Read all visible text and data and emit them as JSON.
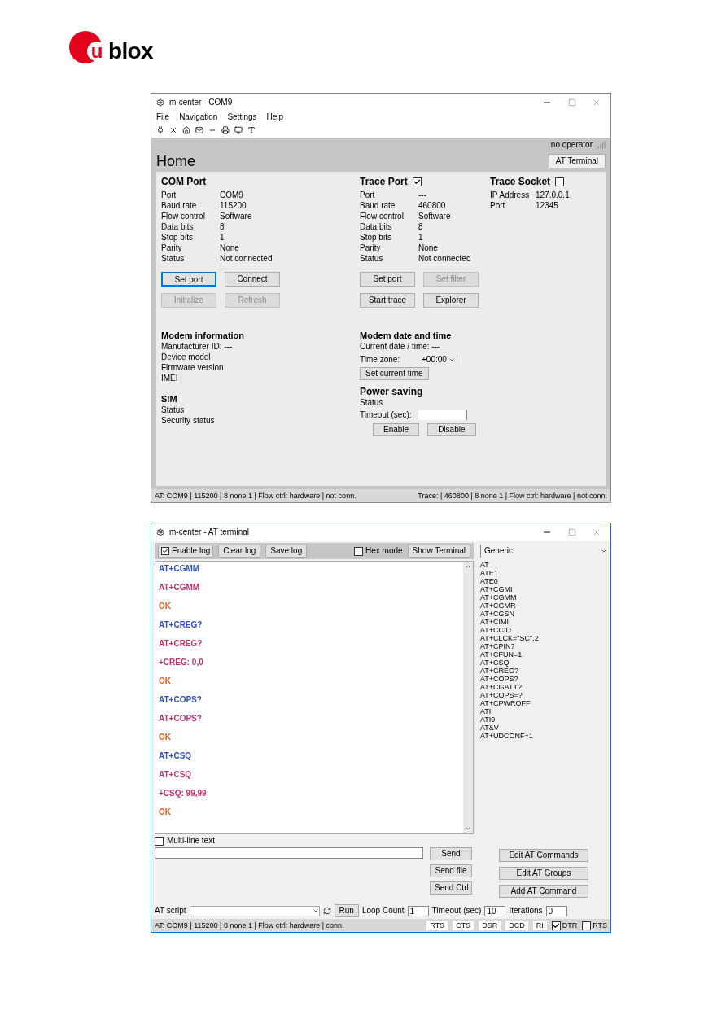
{
  "logo": {
    "mark": "u",
    "word": "blox"
  },
  "home_window": {
    "title": "m-center - COM9",
    "menu": [
      "File",
      "Navigation",
      "Settings",
      "Help"
    ],
    "operator": "no operator",
    "heading": "Home",
    "terminal_button": "AT Terminal",
    "com_port": {
      "title": "COM Port",
      "rows": [
        {
          "label": "Port",
          "value": "COM9"
        },
        {
          "label": "Baud rate",
          "value": "115200"
        },
        {
          "label": "Flow control",
          "value": "Software"
        },
        {
          "label": "Data bits",
          "value": "8"
        },
        {
          "label": "Stop bits",
          "value": "1"
        },
        {
          "label": "Parity",
          "value": "None"
        },
        {
          "label": "Status",
          "value": "Not connected"
        }
      ],
      "buttons": [
        {
          "label": "Set port",
          "disabled": false,
          "focused": true
        },
        {
          "label": "Connect",
          "disabled": false,
          "focused": false
        },
        {
          "label": "Initialize",
          "disabled": true,
          "focused": false
        },
        {
          "label": "Refresh",
          "disabled": true,
          "focused": false
        }
      ]
    },
    "trace_port": {
      "title": "Trace Port",
      "checked": true,
      "rows": [
        {
          "label": "Port",
          "value": "---"
        },
        {
          "label": "Baud rate",
          "value": "460800"
        },
        {
          "label": "Flow control",
          "value": "Software"
        },
        {
          "label": "Data bits",
          "value": "8"
        },
        {
          "label": "Stop bits",
          "value": "1"
        },
        {
          "label": "Parity",
          "value": "None"
        },
        {
          "label": "Status",
          "value": "Not connected"
        }
      ],
      "buttons": [
        {
          "label": "Set port",
          "disabled": false,
          "focused": false
        },
        {
          "label": "Set filter",
          "disabled": true,
          "focused": false
        },
        {
          "label": "Start trace",
          "disabled": false,
          "focused": false
        },
        {
          "label": "Explorer",
          "disabled": false,
          "focused": false
        }
      ]
    },
    "trace_socket": {
      "title": "Trace Socket",
      "checked": false,
      "rows": [
        {
          "label": "IP Address",
          "value": "127.0.0.1"
        },
        {
          "label": "Port",
          "value": "12345"
        }
      ]
    },
    "modem_info": {
      "title": "Modem information",
      "rows": [
        "Manufacturer ID: ---",
        "Device model",
        "Firmware version",
        "IMEI"
      ]
    },
    "modem_time": {
      "title": "Modem date and time",
      "current": "Current date / time: ---",
      "timezone_label": "Time zone:",
      "timezone_value": "+00:00",
      "button": "Set current time"
    },
    "sim": {
      "title": "SIM",
      "rows": [
        "Status",
        "Security status"
      ]
    },
    "power_saving": {
      "title": "Power saving",
      "status": "Status",
      "timeout_label": "Timeout (sec):",
      "buttons": [
        "Enable",
        "Disable"
      ]
    },
    "status_bar": {
      "left": "AT: COM9 | 115200 | 8 none 1 | Flow ctrl: hardware | not conn.",
      "right": "Trace: | 460800 | 8 none 1 | Flow ctrl: hardware | not conn."
    }
  },
  "terminal_window": {
    "title": "m-center - AT terminal",
    "enable_log": {
      "label": "Enable log",
      "checked": true
    },
    "clear_log": "Clear log",
    "save_log": "Save log",
    "hex_mode": {
      "label": "Hex mode",
      "checked": false
    },
    "show_terminal": "Show Terminal",
    "group": "Generic",
    "log": [
      {
        "text": "AT+CGMM",
        "color": "#3050c0"
      },
      {
        "text": "AT+CGMM",
        "color": "#c03070"
      },
      {
        "text": "OK",
        "color": "#e06020"
      },
      {
        "text": "AT+CREG?",
        "color": "#3050c0"
      },
      {
        "text": "AT+CREG?",
        "color": "#c03070"
      },
      {
        "text": "+CREG: 0,0",
        "color": "#c03070"
      },
      {
        "text": "OK",
        "color": "#e06020"
      },
      {
        "text": "AT+COPS?",
        "color": "#3050c0"
      },
      {
        "text": "AT+COPS?",
        "color": "#c03070"
      },
      {
        "text": "OK",
        "color": "#e06020"
      },
      {
        "text": "AT+CSQ",
        "color": "#3050c0"
      },
      {
        "text": "AT+CSQ",
        "color": "#c03070"
      },
      {
        "text": "+CSQ: 99,99",
        "color": "#c03070"
      },
      {
        "text": "OK",
        "color": "#e06020"
      }
    ],
    "commands": [
      "AT",
      "ATE1",
      "ATE0",
      "AT+CGMI",
      "AT+CGMM",
      "AT+CGMR",
      "AT+CGSN",
      "AT+CIMI",
      "AT+CCID",
      "AT+CLCK=\"SC\",2",
      "AT+CPIN?",
      "AT+CFUN=1",
      "AT+CSQ",
      "AT+CREG?",
      "AT+COPS?",
      "AT+CGATT?",
      "AT+COPS=?",
      "AT+CPWROFF",
      "ATI",
      "ATI9",
      "AT&V",
      "AT+UDCONF=1"
    ],
    "multi_line": {
      "label": "Multi-line text",
      "checked": false
    },
    "send_buttons": [
      "Send",
      "Send file",
      "Send Ctrl"
    ],
    "side_buttons": [
      "Edit AT Commands",
      "Edit AT Groups",
      "Add AT Command"
    ],
    "script_label": "AT script",
    "run": "Run",
    "loop_label": "Loop Count",
    "loop_value": "1",
    "timeout_label": "Timeout (sec)",
    "timeout_value": "10",
    "iter_label": "Iterations",
    "iter_value": "0",
    "status_bar": "AT: COM9 | 115200 | 8 none 1 | Flow ctrl: hardware | conn.",
    "signals": [
      {
        "label": "RTS",
        "kind": "cell"
      },
      {
        "label": "CTS",
        "kind": "cell"
      },
      {
        "label": "DSR",
        "kind": "cell"
      },
      {
        "label": "DCD",
        "kind": "cell"
      },
      {
        "label": "RI",
        "kind": "cell"
      },
      {
        "label": "DTR",
        "kind": "check",
        "checked": true
      },
      {
        "label": "RTS",
        "kind": "check",
        "checked": false
      }
    ]
  }
}
